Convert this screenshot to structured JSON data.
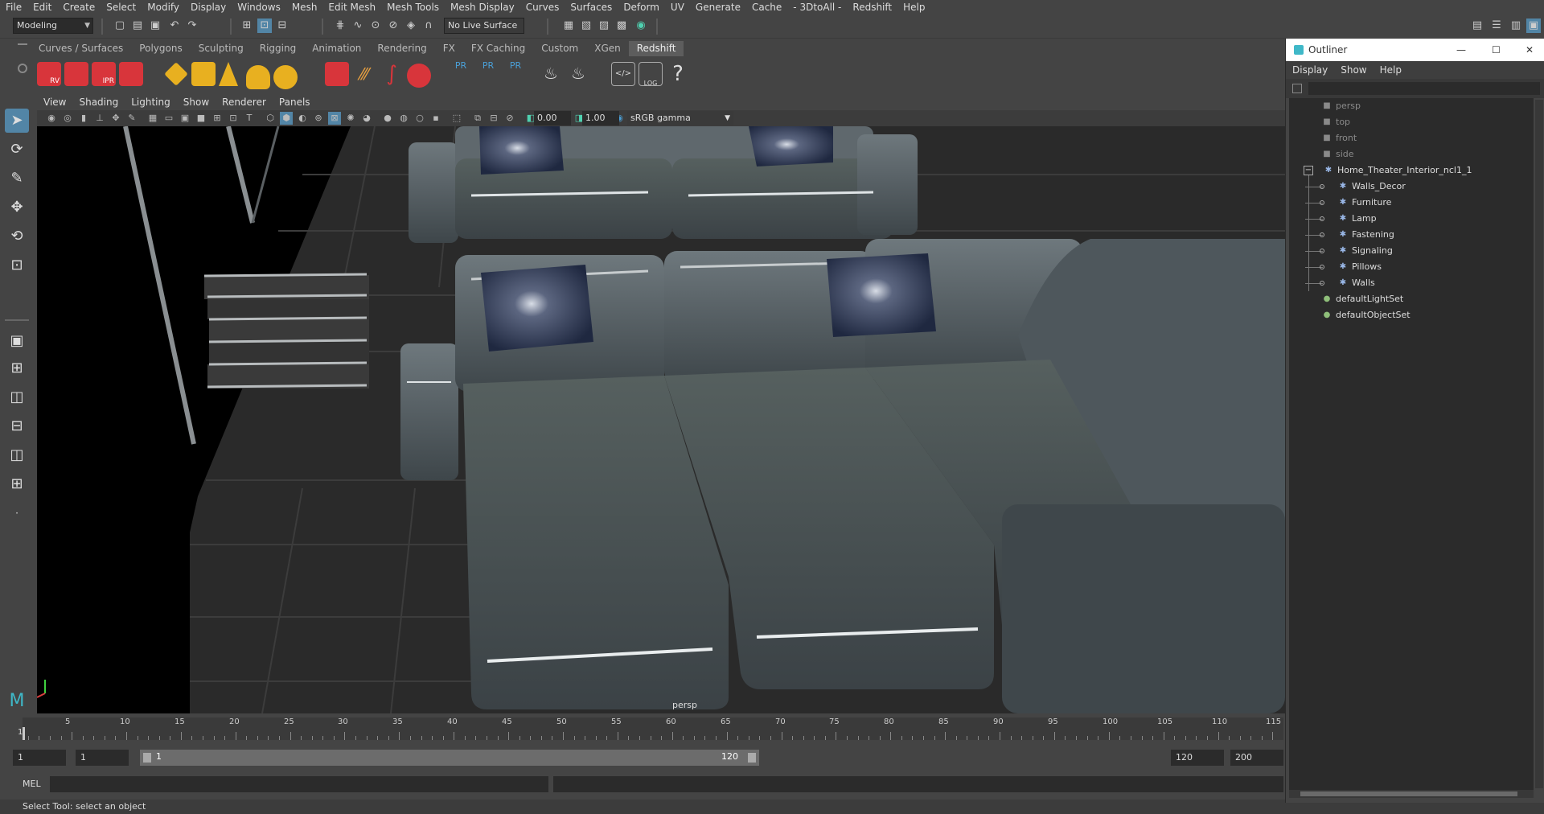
{
  "menubar": [
    "File",
    "Edit",
    "Create",
    "Select",
    "Modify",
    "Display",
    "Windows",
    "Mesh",
    "Edit Mesh",
    "Mesh Tools",
    "Mesh Display",
    "Curves",
    "Surfaces",
    "Deform",
    "UV",
    "Generate",
    "Cache",
    "- 3DtoAll -",
    "Redshift",
    "Help"
  ],
  "status": {
    "workspace": "Modeling",
    "live_surface": "No Live Surface"
  },
  "shelf_tabs": [
    "Curves / Surfaces",
    "Polygons",
    "Sculpting",
    "Rigging",
    "Animation",
    "Rendering",
    "FX",
    "FX Caching",
    "Custom",
    "XGen",
    "Redshift"
  ],
  "shelf_active": "Redshift",
  "shelf_labels": {
    "rv": "RV",
    "ipr": "IPR",
    "pr": "PR",
    "log": "LOG"
  },
  "panel_menu": [
    "View",
    "Shading",
    "Lighting",
    "Show",
    "Renderer",
    "Panels"
  ],
  "panel_fields": {
    "exposure": "0.00",
    "gamma": "1.00",
    "colorspace": "sRGB gamma"
  },
  "viewport": {
    "camera_label": "persp"
  },
  "timeline": {
    "ticks": [
      "5",
      "10",
      "15",
      "20",
      "25",
      "30",
      "35",
      "40",
      "45",
      "50",
      "55",
      "60",
      "65",
      "70",
      "75",
      "80",
      "85",
      "90",
      "95",
      "100",
      "105",
      "110",
      "115"
    ],
    "current_frame": "1"
  },
  "range": {
    "start": "1",
    "playback_start": "1",
    "slider_start": "1",
    "slider_end": "120",
    "playback_end": "120",
    "end": "200"
  },
  "mel": {
    "label": "MEL"
  },
  "help_line": "Select Tool: select an object",
  "outliner": {
    "title": "Outliner",
    "menu": [
      "Display",
      "Show",
      "Help"
    ],
    "items": [
      {
        "label": "persp",
        "dim": true,
        "icon": "camera-icon",
        "indent": 0
      },
      {
        "label": "top",
        "dim": true,
        "icon": "camera-icon",
        "indent": 0
      },
      {
        "label": "front",
        "dim": true,
        "icon": "camera-icon",
        "indent": 0
      },
      {
        "label": "side",
        "dim": true,
        "icon": "camera-icon",
        "indent": 0
      },
      {
        "label": "Home_Theater_Interior_ncl1_1",
        "dim": false,
        "icon": "group-icon",
        "indent": 0
      },
      {
        "label": "Walls_Decor",
        "dim": false,
        "icon": "group-icon",
        "indent": 1
      },
      {
        "label": "Furniture",
        "dim": false,
        "icon": "group-icon",
        "indent": 1
      },
      {
        "label": "Lamp",
        "dim": false,
        "icon": "group-icon",
        "indent": 1
      },
      {
        "label": "Fastening",
        "dim": false,
        "icon": "group-icon",
        "indent": 1
      },
      {
        "label": "Signaling",
        "dim": false,
        "icon": "group-icon",
        "indent": 1
      },
      {
        "label": "Pillows",
        "dim": false,
        "icon": "group-icon",
        "indent": 1
      },
      {
        "label": "Walls",
        "dim": false,
        "icon": "group-icon",
        "indent": 1
      },
      {
        "label": "defaultLightSet",
        "dim": false,
        "icon": "set-icon",
        "indent": 0
      },
      {
        "label": "defaultObjectSet",
        "dim": false,
        "icon": "set-icon",
        "indent": 0
      }
    ]
  },
  "colors": {
    "accent": "#5285a6",
    "shelf_active": "#5d5d5d",
    "sofa": "#4f585d",
    "pillow": "#1f2840"
  }
}
